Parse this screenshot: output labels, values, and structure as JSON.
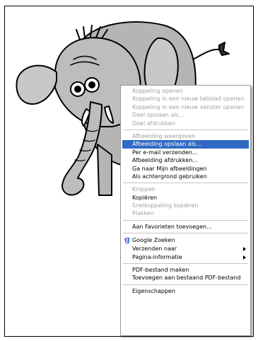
{
  "context_menu": {
    "groups": [
      [
        {
          "label": "Koppeling openen",
          "enabled": false
        },
        {
          "label": "Koppeling in een nieuw tabblad openen",
          "enabled": false
        },
        {
          "label": "Koppeling in een nieuw venster openen",
          "enabled": false
        },
        {
          "label": "Doel opslaan als...",
          "enabled": false
        },
        {
          "label": "Doel afdrukken",
          "enabled": false
        }
      ],
      [
        {
          "label": "Afbeelding weergeven",
          "enabled": false
        },
        {
          "label": "Afbeelding opslaan als...",
          "enabled": true,
          "selected": true
        },
        {
          "label": "Per e-mail verzenden...",
          "enabled": true
        },
        {
          "label": "Afbeelding afdrukken...",
          "enabled": true
        },
        {
          "label": "Ga naar Mijn afbeeldingen",
          "enabled": true
        },
        {
          "label": "Als achtergrond gebruiken",
          "enabled": true
        }
      ],
      [
        {
          "label": "Knippen",
          "enabled": false
        },
        {
          "label": "Kopiëren",
          "enabled": true
        },
        {
          "label": "Snelkoppeling kopiëren",
          "enabled": false
        },
        {
          "label": "Plakken",
          "enabled": false
        }
      ],
      [
        {
          "label": "Aan Favorieten toevoegen...",
          "enabled": true
        }
      ],
      [
        {
          "label": "Google Zoeken",
          "enabled": true,
          "icon": "google-g-icon",
          "icon_glyph": "g"
        },
        {
          "label": "Verzenden naar",
          "enabled": true,
          "submenu": true
        },
        {
          "label": "Pagina-informatie",
          "enabled": true,
          "submenu": true
        }
      ],
      [
        {
          "label": "PDF-bestand maken",
          "enabled": true
        },
        {
          "label": "Toevoegen aan bestaand PDF-bestand",
          "enabled": true
        }
      ],
      [
        {
          "label": "Eigenschappen",
          "enabled": true
        }
      ]
    ]
  },
  "colors": {
    "selection": "#316ac5",
    "disabled_text": "#a0a0a0",
    "google_icon": "#2a5bd7"
  }
}
